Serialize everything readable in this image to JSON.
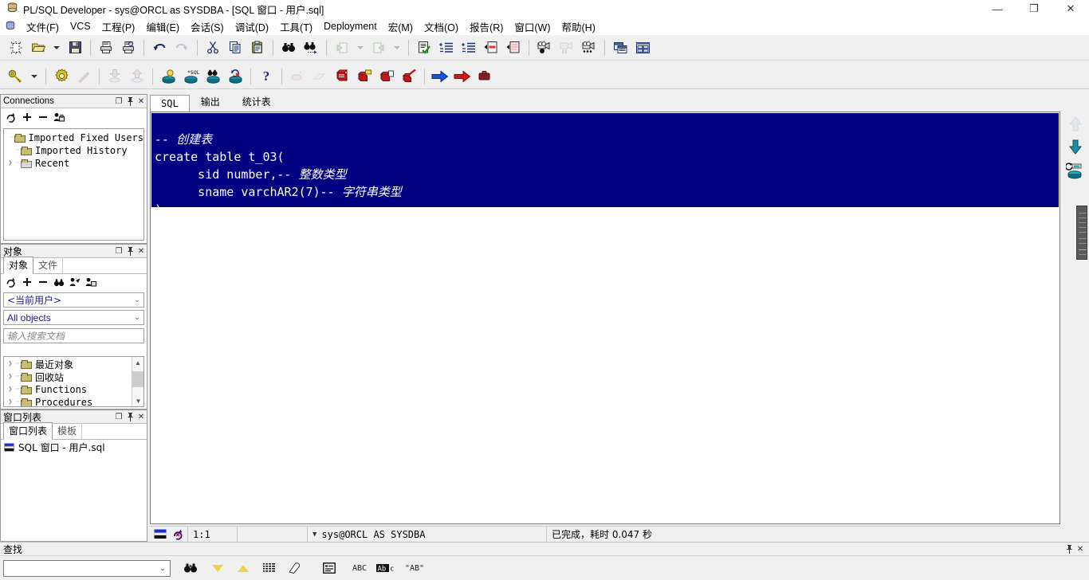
{
  "window": {
    "title": "PL/SQL Developer - sys@ORCL as SYSDBA - [SQL 窗口 - 用户.sql]",
    "minimize": "—",
    "maximize": "❐",
    "close": "✕",
    "mdi_minimize": "_",
    "mdi_restore": "❐",
    "mdi_close": "✕"
  },
  "menu": {
    "items": [
      {
        "label": "文件(F)",
        "name": "menu-file"
      },
      {
        "label": "VCS",
        "name": "menu-vcs"
      },
      {
        "label": "工程(P)",
        "name": "menu-project"
      },
      {
        "label": "编辑(E)",
        "name": "menu-edit"
      },
      {
        "label": "会话(S)",
        "name": "menu-session"
      },
      {
        "label": "调试(D)",
        "name": "menu-debug"
      },
      {
        "label": "工具(T)",
        "name": "menu-tools"
      },
      {
        "label": "Deployment",
        "name": "menu-deployment"
      },
      {
        "label": "宏(M)",
        "name": "menu-macro"
      },
      {
        "label": "文档(O)",
        "name": "menu-document"
      },
      {
        "label": "报告(R)",
        "name": "menu-report"
      },
      {
        "label": "窗口(W)",
        "name": "menu-window"
      },
      {
        "label": "帮助(H)",
        "name": "menu-help"
      }
    ]
  },
  "toolbar_row1": {
    "icons": [
      "new-icon",
      "open-icon",
      "open-dropdown-icon",
      "save-icon",
      "print-icon",
      "print-preview-icon",
      "undo-icon",
      "redo-icon",
      "cut-icon",
      "copy-icon",
      "paste-icon",
      "find-icon",
      "find-next-icon",
      "back-icon",
      "back-dropdown-icon",
      "forward-icon",
      "forward-dropdown-icon",
      "check-syntax-icon",
      "indent-icon",
      "unindent-icon",
      "comment-icon",
      "uncomment-icon",
      "record-macro-icon",
      "pause-macro-icon",
      "play-macro-icon",
      "cascade-windows-icon",
      "tile-windows-icon"
    ]
  },
  "toolbar_row2": {
    "icons": [
      "key-icon",
      "key-dropdown-icon",
      "settings-icon",
      "lightning-icon",
      "import-icon",
      "export-icon",
      "explain-plan-icon",
      "sql-window-icon",
      "test-window-icon",
      "rollback-icon",
      "help-icon",
      "breakpoint-add-icon",
      "breakpoint-list-icon",
      "step-icon",
      "step-into-icon",
      "step-over-icon",
      "step-out-icon",
      "run-icon",
      "run-step-icon",
      "stop-icon"
    ]
  },
  "connections_panel": {
    "title": "Connections",
    "buttons": [
      "refresh-icon",
      "add-icon",
      "remove-icon",
      "edit-user-icon"
    ],
    "header_controls": [
      "restore-icon",
      "pin-icon",
      "close-icon"
    ],
    "tree": [
      {
        "label": "Imported Fixed Users",
        "expandable": false,
        "type": "folder"
      },
      {
        "label": "Imported History",
        "expandable": false,
        "type": "folder"
      },
      {
        "label": "Recent",
        "expandable": true,
        "type": "folder-grey"
      }
    ]
  },
  "objects_panel": {
    "title": "对象",
    "tabs": [
      {
        "label": "对象",
        "active": true
      },
      {
        "label": "文件",
        "active": false
      }
    ],
    "buttons": [
      "refresh-icon",
      "add-icon",
      "remove-icon",
      "find-icon",
      "filter-icon",
      "user-icon"
    ],
    "user_filter": "<当前用户>",
    "object_filter": "All objects",
    "search_placeholder": "输入搜索文档",
    "tree": [
      {
        "label": "最近对象",
        "expandable": true
      },
      {
        "label": "回收站",
        "expandable": true
      },
      {
        "label": "Functions",
        "expandable": true
      },
      {
        "label": "Procedures",
        "expandable": true
      }
    ]
  },
  "windowlist_panel": {
    "title": "窗口列表",
    "tabs": [
      {
        "label": "窗口列表",
        "active": true
      },
      {
        "label": "模板",
        "active": false
      }
    ],
    "items": [
      {
        "label": "SQL 窗口 - 用户.sql",
        "icon": "sql-window-icon"
      }
    ]
  },
  "editor": {
    "tabs": [
      {
        "label": "SQL",
        "active": true,
        "name": "tab-sql"
      },
      {
        "label": "输出",
        "active": false,
        "name": "tab-output"
      },
      {
        "label": "统计表",
        "active": false,
        "name": "tab-statistics"
      }
    ],
    "code_lines": [
      [
        {
          "t": "-- 创建表",
          "c": "comment"
        }
      ],
      [
        {
          "t": "create table t_03(",
          "c": "code"
        }
      ],
      [
        {
          "t": "      sid number,",
          "c": "code"
        },
        {
          "t": "-- 整数类型",
          "c": "comment"
        }
      ],
      [
        {
          "t": "      sname varchAR2(7)",
          "c": "code"
        },
        {
          "t": "-- 字符串类型",
          "c": "comment"
        }
      ],
      [
        {
          "t": ")",
          "c": "code"
        }
      ]
    ],
    "selection_bg": "#000080",
    "selection_fg": "#ffffff",
    "side_tools": [
      "upload-up-icon",
      "download-down-icon",
      "db-commit-icon"
    ]
  },
  "statusbar": {
    "flag_icon": "flag-icon",
    "refresh_icon": "rollback-icon",
    "position": "1:1",
    "blank": "",
    "connection": "sys@ORCL AS SYSDBA",
    "connection_chevron": "▼",
    "message": "已完成，耗时 0.047 秒"
  },
  "findbar": {
    "title": "查找",
    "header_controls": [
      "pin-icon",
      "close-icon"
    ],
    "input_value": "",
    "buttons": [
      {
        "name": "find-icon",
        "glyph": "binoculars"
      },
      {
        "name": "find-next-down-icon",
        "glyph": "tri-down"
      },
      {
        "name": "find-previous-up-icon",
        "glyph": "tri-up"
      },
      {
        "name": "find-all-icon",
        "glyph": "lines"
      },
      {
        "name": "highlight-icon",
        "glyph": "eraser"
      },
      {
        "name": "find-in-list-icon",
        "glyph": "listbox"
      },
      {
        "name": "whole-word-icon",
        "glyph": "ABC"
      },
      {
        "name": "match-case-icon",
        "glyph": "AbC"
      },
      {
        "name": "regex-icon",
        "glyph": "\"AB\""
      }
    ]
  },
  "colors": {
    "title_bg": "#ffffff",
    "toolbar_bg": "#f0f0f0",
    "editor_selection": "#000080",
    "folder_yellow": "#c8bd72",
    "accent_blue": "#1a1a8c"
  }
}
